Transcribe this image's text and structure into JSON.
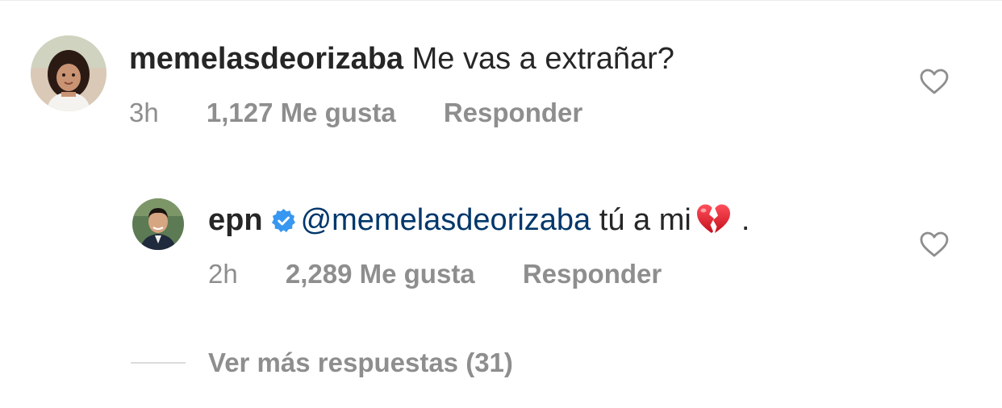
{
  "comment": {
    "username": "memelasdeorizaba",
    "text": "Me vas a extrañar?",
    "time": "3h",
    "likes": "1,127 Me gusta",
    "reply_label": "Responder"
  },
  "reply": {
    "username": "epn",
    "verified": true,
    "mention": "@memelasdeorizaba",
    "text": "tú a mi",
    "emoji": "broken-heart",
    "trailing": ".",
    "time": "2h",
    "likes": "2,289 Me gusta",
    "reply_label": "Responder"
  },
  "view_more": {
    "label": "Ver más respuestas (31)"
  },
  "colors": {
    "text": "#262626",
    "secondary": "#8e8e8e",
    "mention": "#00376b",
    "verified": "#3897f0",
    "emoji": "#e0202e"
  }
}
